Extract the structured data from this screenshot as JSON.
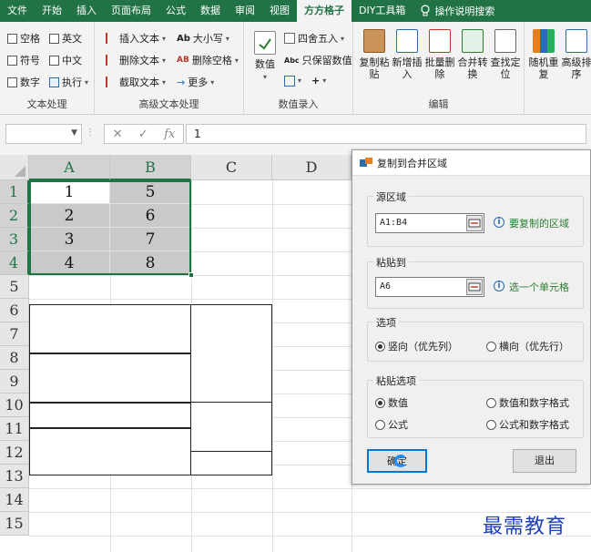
{
  "menubar": {
    "items": [
      "文件",
      "开始",
      "插入",
      "页面布局",
      "公式",
      "数据",
      "审阅",
      "视图",
      "方方格子",
      "DIY工具箱"
    ],
    "active_index": 8,
    "search_label": "操作说明搜索"
  },
  "ribbon": {
    "text_group": {
      "label": "文本处理",
      "checks": [
        "空格",
        "英文",
        "符号",
        "中文",
        "数字"
      ],
      "exec_label": "执行"
    },
    "adv_text_group": {
      "label": "高级文本处理",
      "items": [
        "插入文本",
        "删除文本",
        "截取文本",
        "大小写",
        "删除空格",
        "更多"
      ]
    },
    "num_group": {
      "label": "数值录入",
      "big_label": "数值",
      "items": [
        "四舍五入",
        "只保留数值"
      ]
    },
    "edit_group": {
      "label": "编辑",
      "buttons": [
        "复制粘贴",
        "新增插入",
        "批量删除",
        "合并转换",
        "查找定位"
      ]
    },
    "extra_group": {
      "buttons": [
        "随机重复",
        "高级排序"
      ]
    }
  },
  "formula_bar": {
    "value": "1"
  },
  "sheet": {
    "columns": [
      "A",
      "B",
      "C",
      "D"
    ],
    "rows": [
      "1",
      "2",
      "3",
      "4",
      "5",
      "6",
      "7",
      "8",
      "9",
      "10",
      "11",
      "12",
      "13",
      "14",
      "15"
    ],
    "colA": [
      "1",
      "2",
      "3",
      "4"
    ],
    "colB": [
      "5",
      "6",
      "7",
      "8"
    ]
  },
  "dialog": {
    "title": "复制到合并区域",
    "source": {
      "legend": "源区域",
      "value": "A1:B4",
      "hint": "要复制的区域"
    },
    "paste": {
      "legend": "粘贴到",
      "value": "A6",
      "hint": "选一个单元格"
    },
    "options": {
      "legend": "选项",
      "vertical": "竖向（优先列）",
      "horizontal": "横向（优先行）"
    },
    "paste_options": {
      "legend": "粘贴选项",
      "value": "数值",
      "value_fmt": "数值和数字格式",
      "formula": "公式",
      "formula_fmt": "公式和数字格式"
    },
    "ok_label": "确定",
    "exit_label": "退出"
  },
  "watermark": "最需教育",
  "colors": {
    "excel_green": "#217346",
    "hint_green": "#2e7d32",
    "focus_blue": "#0078d7"
  }
}
